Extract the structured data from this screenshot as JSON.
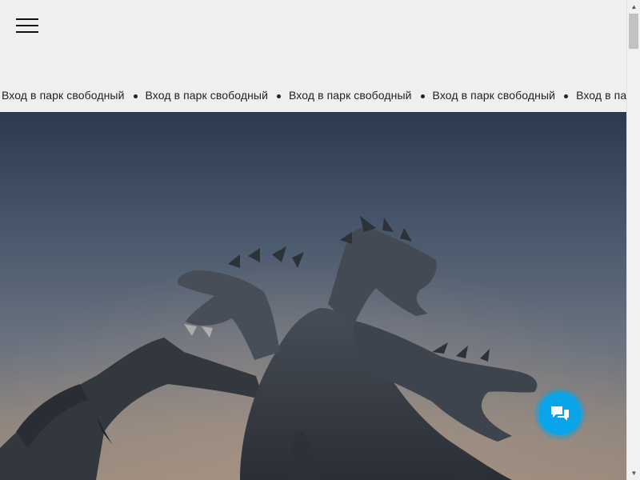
{
  "header": {
    "menu_icon": "hamburger-menu-icon"
  },
  "ticker": {
    "items": [
      "Вход в парк свободный",
      "Вход в парк свободный",
      "Вход в парк свободный",
      "Вход в парк свободный",
      "Вход в парк свободный"
    ]
  },
  "hero": {
    "image_subject": "three-headed dragon statue against evening sky"
  },
  "chat_widget": {
    "icon": "chat-bubbles-icon",
    "color": "#0aa5e8"
  },
  "scrollbar": {
    "up_arrow": "▲",
    "down_arrow": "▼"
  }
}
